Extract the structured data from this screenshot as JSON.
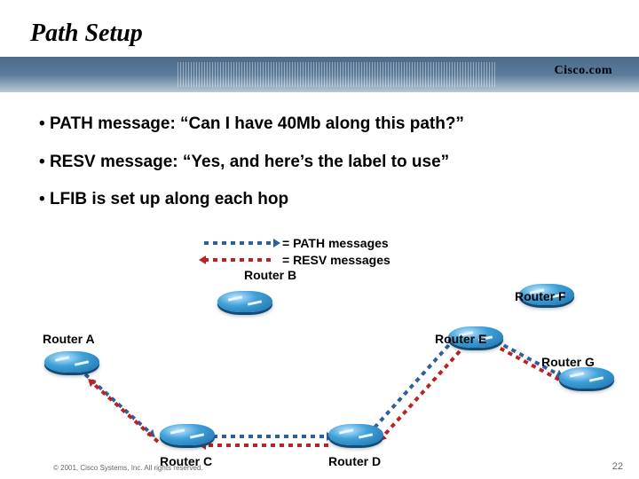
{
  "title": "Path Setup",
  "logo": "Cisco.com",
  "bullets": [
    "PATH message: “Can I have 40Mb along this path?”",
    "RESV message: “Yes, and here’s the label to use”",
    "LFIB is set up along each hop"
  ],
  "legend": {
    "path": "=  PATH messages",
    "resv": "=  RESV messages"
  },
  "routers": {
    "a": "Router A",
    "b": "Router B",
    "c": "Router C",
    "d": "Router D",
    "e": "Router E",
    "f": "Router F",
    "g": "Router G"
  },
  "copyright": "© 2001, Cisco Systems, Inc. All rights reserved.",
  "pagenum": "22"
}
